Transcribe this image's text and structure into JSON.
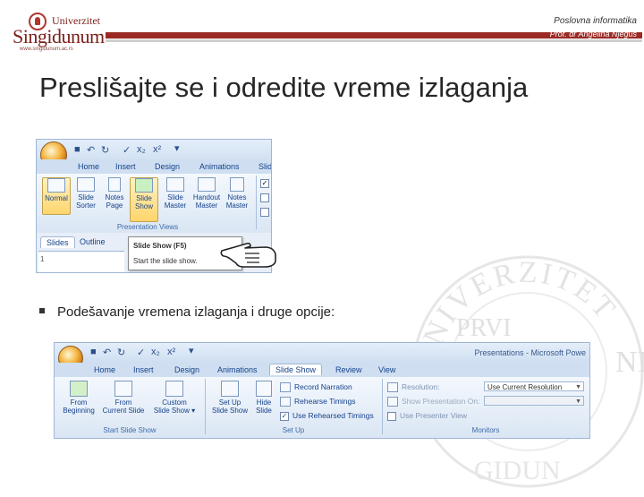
{
  "header": {
    "logo_top": "Univerzitet",
    "logo_name": "Singidunum",
    "logo_url": "www.singidunum.ac.rs",
    "course": "Poslovna informatika",
    "professor": "Prof. dr Angelina Njeguš"
  },
  "title": "Preslišajte se i odredite vreme izlaganja",
  "screenshot1": {
    "tabs": [
      "Home",
      "Insert",
      "Design",
      "Animations",
      "Slid"
    ],
    "buttons": [
      {
        "label1": "Normal",
        "label2": ""
      },
      {
        "label1": "Slide",
        "label2": "Sorter"
      },
      {
        "label1": "Notes",
        "label2": "Page"
      },
      {
        "label1": "Slide",
        "label2": "Show"
      },
      {
        "label1": "Slide",
        "label2": "Master"
      },
      {
        "label1": "Handout",
        "label2": "Master"
      },
      {
        "label1": "Notes",
        "label2": "Master"
      }
    ],
    "group_label": "Presentation Views",
    "pane_tabs": [
      "Slides",
      "Outline"
    ],
    "pane_number": "1",
    "tooltip_title": "Slide Show (F5)",
    "tooltip_body": "Start the slide show."
  },
  "bullet": "Podešavanje vremena izlaganja i druge opcije:",
  "screenshot2": {
    "window_title": "Presentations - Microsoft Powe",
    "tabs": [
      "Home",
      "Insert",
      "Design",
      "Animations",
      "Slide Show",
      "Review",
      "View"
    ],
    "active_tab": "Slide Show",
    "start_buttons": [
      {
        "label1": "From",
        "label2": "Beginning"
      },
      {
        "label1": "From",
        "label2": "Current Slide"
      },
      {
        "label1": "Custom",
        "label2": "Slide Show ▾"
      }
    ],
    "start_group": "Start Slide Show",
    "setup_buttons": [
      {
        "label1": "Set Up",
        "label2": "Slide Show"
      },
      {
        "label1": "Hide",
        "label2": "Slide"
      }
    ],
    "setup_items": [
      "Record Narration",
      "Rehearse Timings",
      "Use Rehearsed Timings"
    ],
    "setup_group": "Set Up",
    "monitors": {
      "resolution_label": "Resolution:",
      "resolution_value": "Use Current Resolution",
      "show_on_label": "Show Presentation On:",
      "presenter_view": "Use Presenter View",
      "group": "Monitors"
    }
  },
  "watermark": {
    "ring_text": "UNIVERZITET",
    "center": "PRVI",
    "side": "NI",
    "bottom": "GIDUN"
  },
  "colors": {
    "brand_red": "#9b2a24",
    "ribbon_text": "#15428b"
  }
}
